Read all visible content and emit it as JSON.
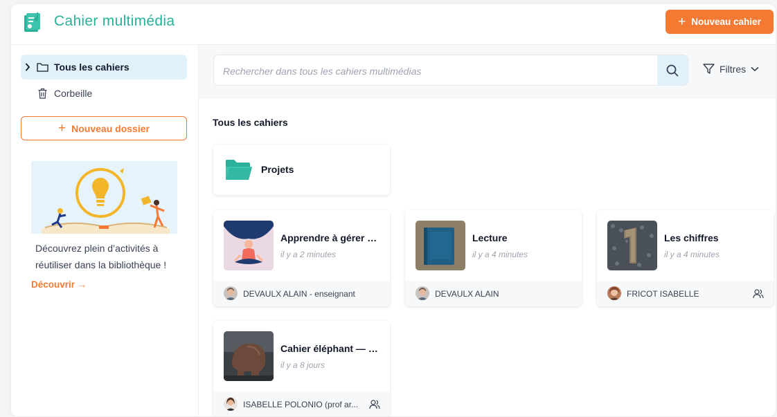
{
  "header": {
    "app_title": "Cahier multimédia",
    "new_notebook_label": "Nouveau cahier"
  },
  "sidebar": {
    "items": [
      {
        "label": "Tous les cahiers",
        "icon": "folder-icon",
        "active": true
      },
      {
        "label": "Corbeille",
        "icon": "trash-icon",
        "active": false
      }
    ],
    "new_folder_label": "Nouveau dossier",
    "promo": {
      "text": "Découvrez plein d’activités à réutiliser dans la bibliothèque !",
      "link": "Découvrir"
    }
  },
  "main": {
    "search": {
      "placeholder": "Rechercher dans tous les cahiers multimédias",
      "value": ""
    },
    "filters_label": "Filtres",
    "section_title": "Tous les cahiers",
    "folders": [
      {
        "name": "Projets"
      }
    ],
    "notebooks": [
      {
        "title": "Apprendre à gérer s...",
        "time": "il y a 2 minutes",
        "author": "DEVAULX ALAIN - enseignant",
        "shared": false
      },
      {
        "title": "Lecture",
        "time": "il y a 4 minutes",
        "author": "DEVAULX ALAIN",
        "shared": false
      },
      {
        "title": "Les chiffres",
        "time": "il y a 4 minutes",
        "author": "FRICOT ISABELLE",
        "shared": true
      },
      {
        "title": "Cahier éléphant — C...",
        "time": "il y a 8 jours",
        "author": "ISABELLE POLONIO (prof ar...",
        "shared": true
      }
    ]
  },
  "colors": {
    "accent": "#f47a34",
    "brand": "#2bb09a",
    "active_bg": "#e1f1fc"
  }
}
